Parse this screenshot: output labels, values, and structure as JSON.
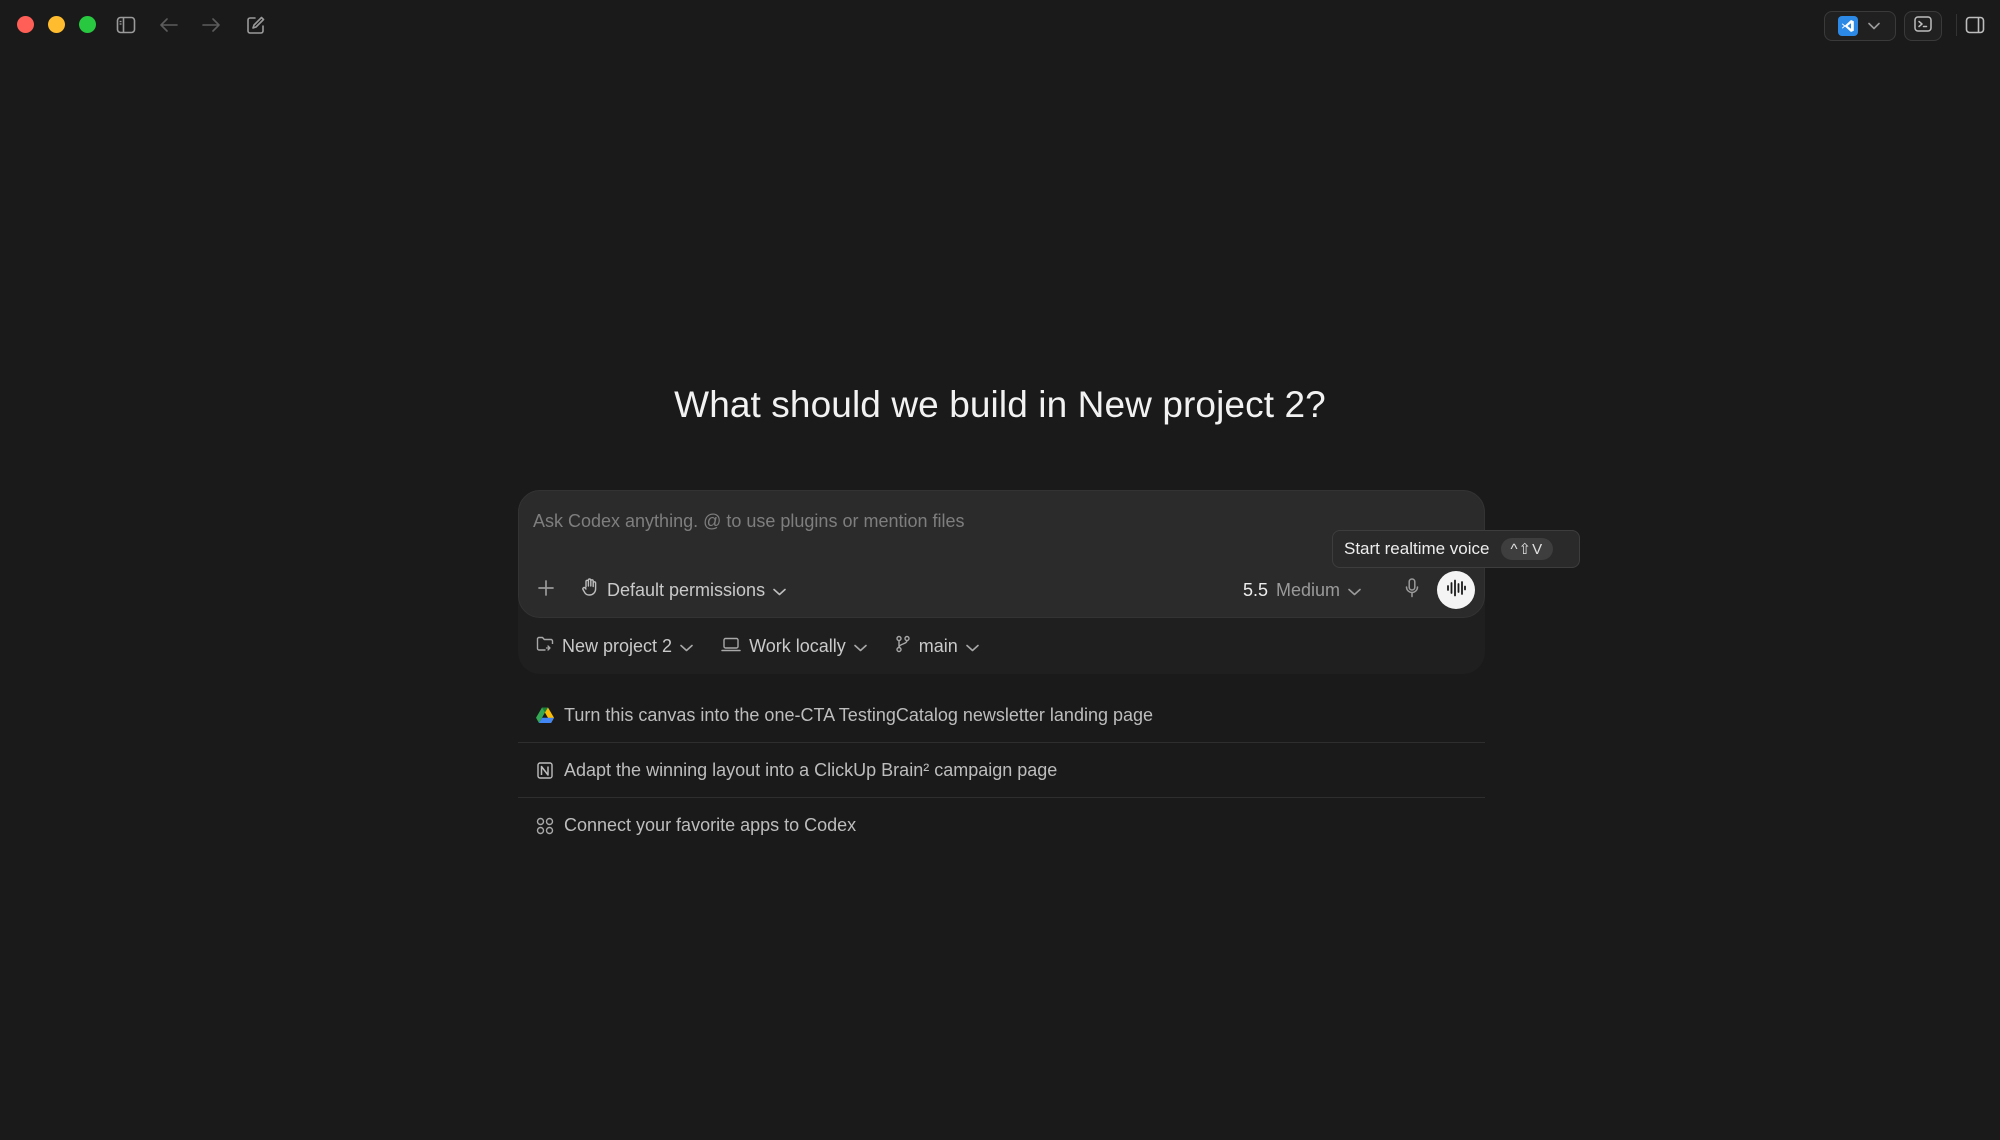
{
  "heading": "What should we build in New project 2?",
  "composer": {
    "placeholder": "Ask Codex anything. @ to use plugins or mention files",
    "permissions_label": "Default permissions",
    "model_version": "5.5",
    "model_effort": "Medium"
  },
  "tooltip": {
    "label": "Start realtime voice",
    "shortcut": "^⇧V"
  },
  "context": {
    "project": "New project 2",
    "location": "Work locally",
    "branch": "main"
  },
  "suggestions": [
    {
      "icon": "google-drive-icon",
      "label": "Turn this canvas into the one-CTA TestingCatalog newsletter landing page"
    },
    {
      "icon": "notion-icon",
      "label": "Adapt the winning layout into a ClickUp Brain² campaign page"
    },
    {
      "icon": "apps-grid-icon",
      "label": "Connect your favorite apps to Codex"
    }
  ],
  "colors": {
    "background": "#1a1a1a",
    "composer": "#2b2b2b",
    "close": "#ff5f57",
    "minimize": "#febc2e",
    "maximize": "#28c840",
    "ide_brand": "#2c8ae6"
  }
}
